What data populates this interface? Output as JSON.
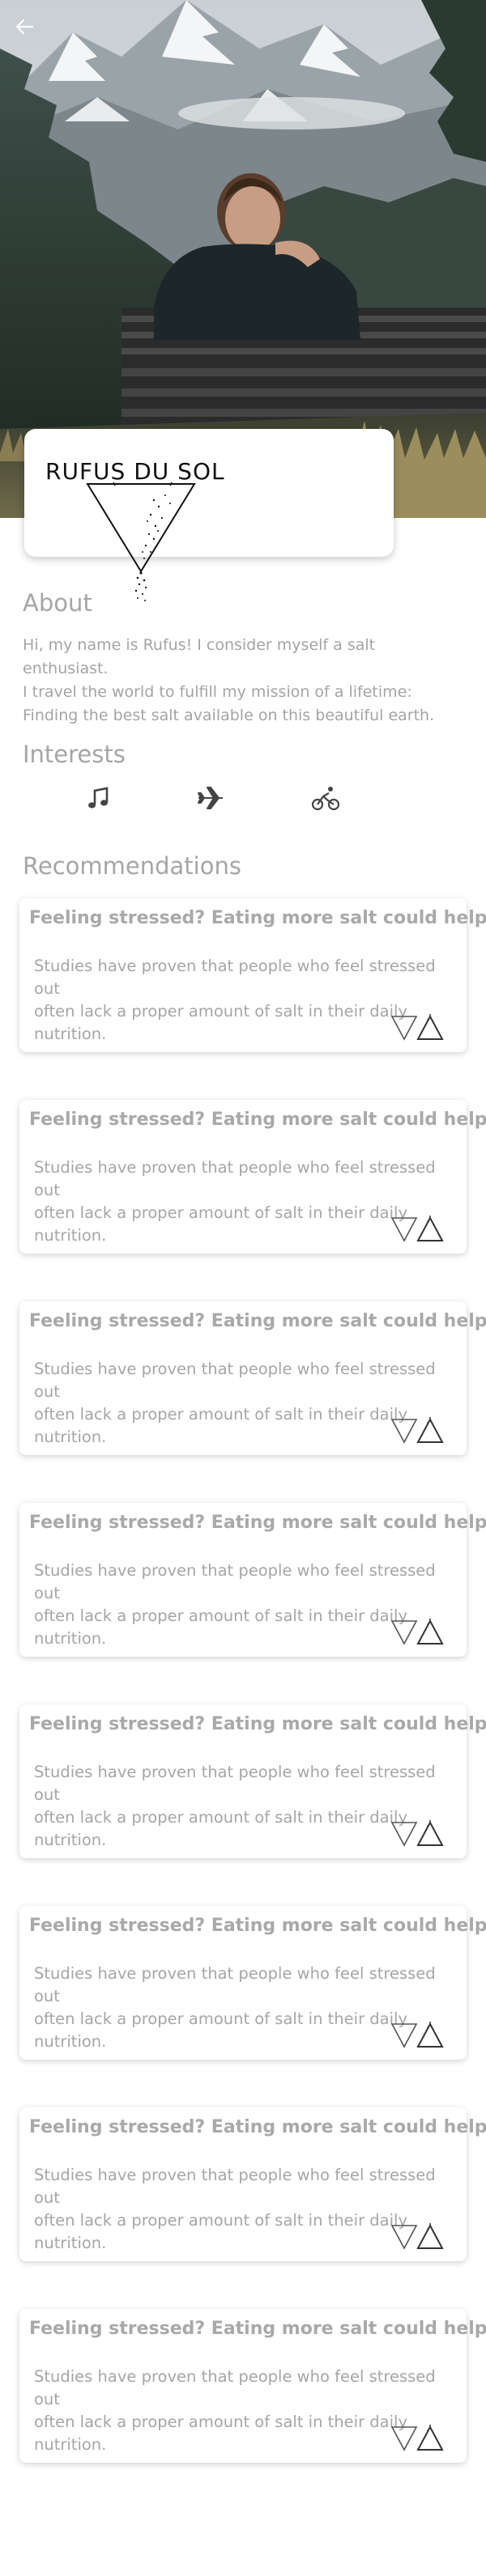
{
  "hero": {
    "alt": "person on bench facing mountains"
  },
  "nav": {
    "back_icon": "arrow-left-icon"
  },
  "logo": {
    "text": "RUFUS DU SOL"
  },
  "about": {
    "title": "About",
    "lines": [
      "Hi, my name is Rufus! I consider myself a salt enthusiast.",
      "I travel the world to fulfill my mission of a lifetime:",
      "Finding the best salt available on this beautiful earth."
    ]
  },
  "interests": {
    "title": "Interests",
    "icons": [
      "music-note-icon",
      "airplane-icon",
      "bicycle-icon"
    ]
  },
  "recommendations": {
    "title": "Recommendations",
    "cards": [
      {
        "title": "Feeling stressed? Eating more salt could help!",
        "body": "Studies have proven that people who feel stressed out\noften lack a proper amount of salt in their daily nutrition."
      },
      {
        "title": "Feeling stressed? Eating more salt could help!",
        "body": "Studies have proven that people who feel stressed out\noften lack a proper amount of salt in their daily nutrition."
      },
      {
        "title": "Feeling stressed? Eating more salt could help!",
        "body": "Studies have proven that people who feel stressed out\noften lack a proper amount of salt in their daily nutrition."
      },
      {
        "title": "Feeling stressed? Eating more salt could help!",
        "body": "Studies have proven that people who feel stressed out\noften lack a proper amount of salt in their daily nutrition."
      },
      {
        "title": "Feeling stressed? Eating more salt could help!",
        "body": "Studies have proven that people who feel stressed out\noften lack a proper amount of salt in their daily nutrition."
      },
      {
        "title": "Feeling stressed? Eating more salt could help!",
        "body": "Studies have proven that people who feel stressed out\noften lack a proper amount of salt in their daily nutrition."
      },
      {
        "title": "Feeling stressed? Eating more salt could help!",
        "body": "Studies have proven that people who feel stressed out\noften lack a proper amount of salt in their daily nutrition."
      },
      {
        "title": "Feeling stressed? Eating more salt could help!",
        "body": "Studies have proven that people who feel stressed out\noften lack a proper amount of salt in their daily nutrition."
      }
    ]
  }
}
